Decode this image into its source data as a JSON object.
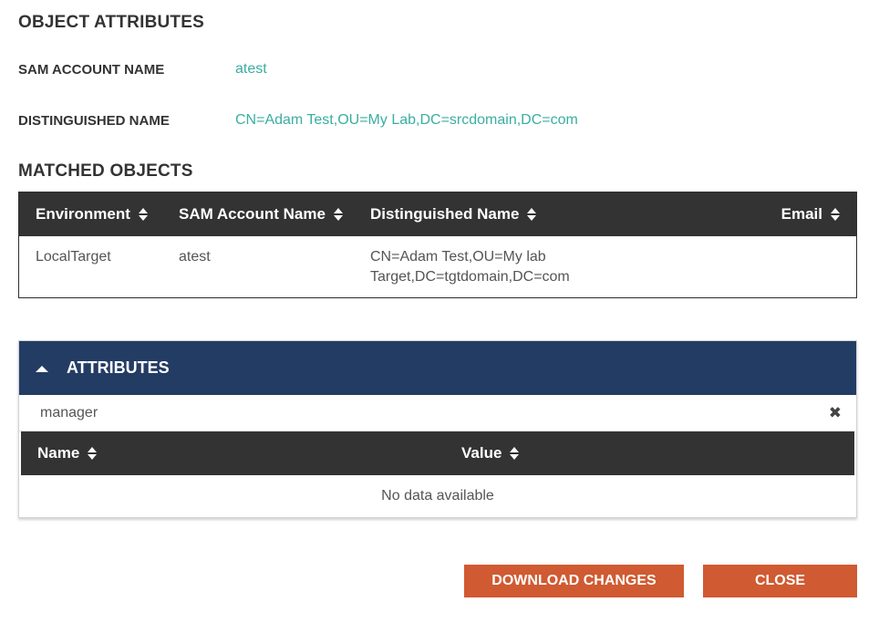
{
  "object_attributes": {
    "title": "OBJECT ATTRIBUTES",
    "sam_label": "SAM ACCOUNT NAME",
    "sam_value": "atest",
    "dn_label": "DISTINGUISHED NAME",
    "dn_value": "CN=Adam Test,OU=My Lab,DC=srcdomain,DC=com"
  },
  "matched_objects": {
    "title": "MATCHED OBJECTS",
    "columns": [
      "Environment",
      "SAM Account Name",
      "Distinguished Name",
      "Email"
    ],
    "rows": [
      {
        "environment": "LocalTarget",
        "sam": "atest",
        "dn_line1": "CN=Adam Test,OU=My lab",
        "dn_line2": "Target,DC=tgtdomain,DC=com",
        "email": ""
      }
    ]
  },
  "attributes_panel": {
    "title": "ATTRIBUTES",
    "search_value": "manager",
    "clear_icon": "close-icon",
    "columns": [
      "Name",
      "Value"
    ],
    "empty_text": "No data available"
  },
  "buttons": {
    "download": "DOWNLOAD CHANGES",
    "close": "CLOSE"
  },
  "colors": {
    "accent_link": "#3aaea0",
    "table_header": "#333333",
    "panel_header": "#233c63",
    "button": "#d05a31"
  }
}
